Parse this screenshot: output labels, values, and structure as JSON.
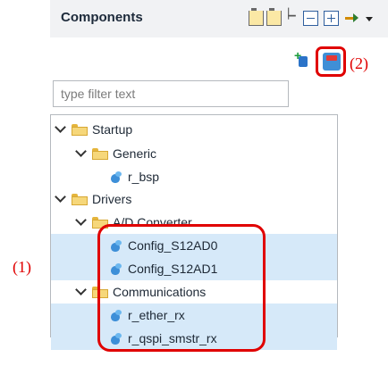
{
  "header": {
    "title": "Components"
  },
  "toolbar": {
    "icons": [
      "folder-up-icon",
      "folder-link-icon",
      "sort-icon",
      "collapse-all-icon",
      "expand-all-icon",
      "link-icon",
      "view-menu-icon"
    ]
  },
  "actions": {
    "add_icon": "add-component-icon",
    "remove_icon": "remove-component-icon"
  },
  "filter": {
    "placeholder": "type filter text"
  },
  "tree": {
    "nodes": [
      {
        "label": "Startup",
        "type": "folder",
        "expanded": true
      },
      {
        "label": "Generic",
        "type": "folder",
        "expanded": true
      },
      {
        "label": "r_bsp",
        "type": "component"
      },
      {
        "label": "Drivers",
        "type": "folder",
        "expanded": true
      },
      {
        "label": "A/D Converter",
        "type": "folder",
        "expanded": true
      },
      {
        "label": "Config_S12AD0",
        "type": "component",
        "selected": true
      },
      {
        "label": "Config_S12AD1",
        "type": "component",
        "selected": true
      },
      {
        "label": "Communications",
        "type": "folder",
        "expanded": true
      },
      {
        "label": "r_ether_rx",
        "type": "component",
        "selected": true
      },
      {
        "label": "r_qspi_smstr_rx",
        "type": "component",
        "selected": true
      }
    ]
  },
  "annotations": {
    "callout_1": "(1)",
    "callout_2": "(2)",
    "highlight_color": "#e00000"
  },
  "colors": {
    "selection": "#d6e9f9",
    "header_bg": "#f1f2f4"
  }
}
